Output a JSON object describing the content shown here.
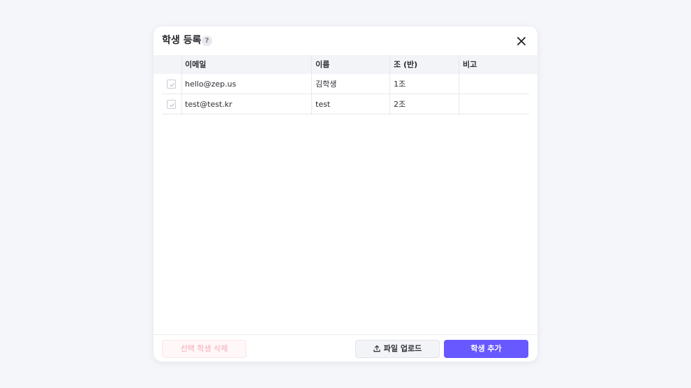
{
  "modal": {
    "title": "학생 등록",
    "help_symbol": "?"
  },
  "table": {
    "headers": [
      "이메일",
      "이름",
      "조 (반)",
      "비고"
    ],
    "rows": [
      {
        "email": "hello@zep.us",
        "name": "김학생",
        "group": "1조",
        "note": ""
      },
      {
        "email": "test@test.kr",
        "name": "test",
        "group": "2조",
        "note": ""
      }
    ]
  },
  "footer": {
    "delete_label": "선택 학생 삭제",
    "upload_label": "파일 업로드",
    "add_label": "학생 추가"
  },
  "colors": {
    "primary": "#6758ff",
    "danger_text": "#f4aab5",
    "header_bg": "#f3f4f8"
  },
  "icons": {
    "help": "question-icon",
    "close": "close-icon",
    "upload": "upload-icon",
    "check": "check-icon"
  }
}
